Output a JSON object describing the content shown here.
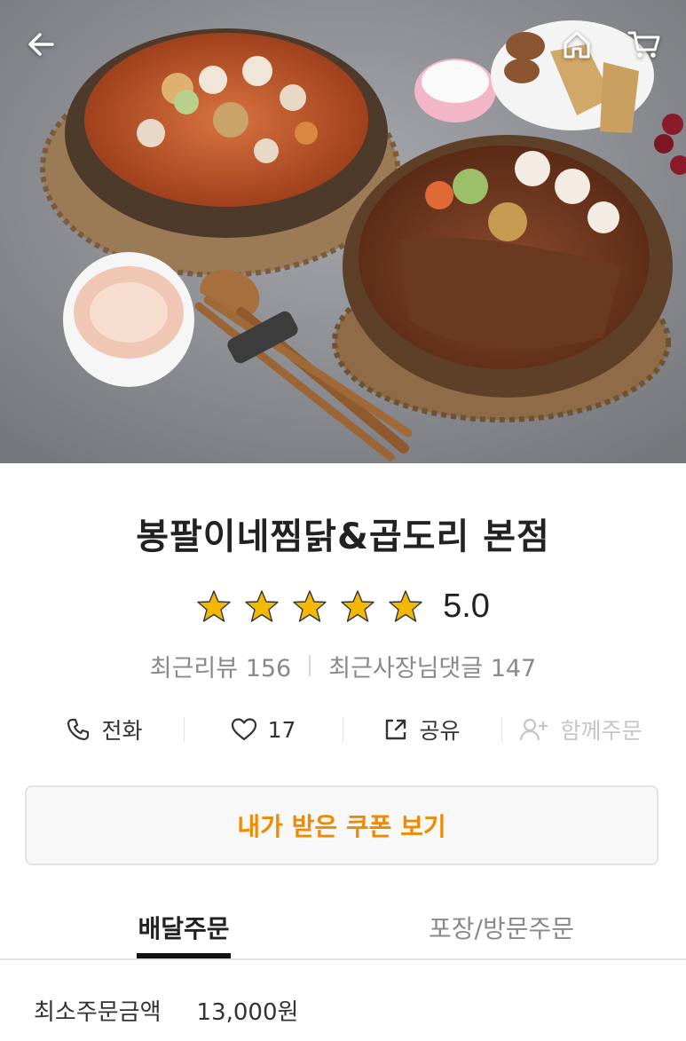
{
  "hero": {
    "back_icon": "arrow-left-icon",
    "home_icon": "home-icon",
    "cart_icon": "cart-icon"
  },
  "store": {
    "name": "봉팔이네찜닭&곱도리 본점",
    "rating": "5.0",
    "rating_stars": 5,
    "recent_reviews": "최근리뷰 156",
    "owner_replies": "최근사장님댓글 147"
  },
  "actions": {
    "call_label": "전화",
    "like_count": "17",
    "share_label": "공유",
    "group_order_label": "함께주문"
  },
  "coupon": {
    "label": "내가 받은 쿠폰 보기"
  },
  "tabs": [
    {
      "label": "배달주문",
      "active": true
    },
    {
      "label": "포장/방문주문",
      "active": false
    }
  ],
  "order_info": {
    "min_order_label": "최소주문금액",
    "min_order_value": "13,000원"
  },
  "colors": {
    "accent": "#f08a00",
    "star": "#f5b800",
    "muted_text": "#8a8a8a"
  }
}
